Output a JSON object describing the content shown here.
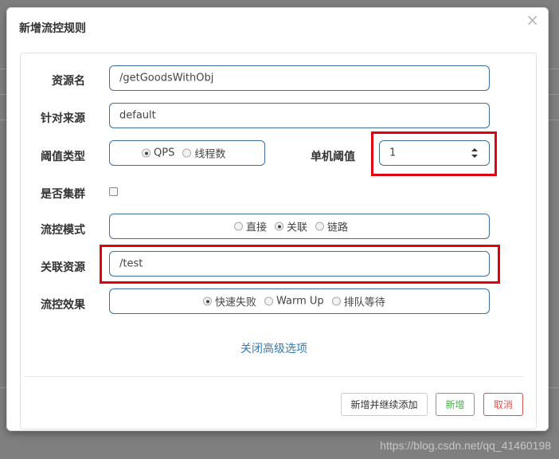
{
  "dialog": {
    "title": "新增流控规则",
    "close_glyph": "×"
  },
  "form": {
    "resource_name": {
      "label": "资源名",
      "value": "/getGoodsWithObj"
    },
    "limit_app": {
      "label": "针对来源",
      "value": "default"
    },
    "threshold_type": {
      "label": "阈值类型",
      "options": [
        "QPS",
        "线程数"
      ],
      "selected": "QPS"
    },
    "single_threshold": {
      "label": "单机阈值",
      "value": "1"
    },
    "cluster_mode": {
      "label": "是否集群",
      "checked": false
    },
    "strategy": {
      "label": "流控模式",
      "options": [
        "直接",
        "关联",
        "链路"
      ],
      "selected": "关联"
    },
    "ref_resource": {
      "label": "关联资源",
      "value": "/test"
    },
    "control_behavior": {
      "label": "流控效果",
      "options": [
        "快速失败",
        "Warm Up",
        "排队等待"
      ],
      "selected": "快速失败"
    },
    "advanced_toggle": "关闭高级选项"
  },
  "footer": {
    "add_and_continue": "新增并继续添加",
    "add": "新增",
    "cancel": "取消"
  },
  "watermark": "https://blog.csdn.net/qq_41460198",
  "colors": {
    "highlight_border": "#e3000f",
    "field_border": "#3f6e9c",
    "link": "#337ab7",
    "success": "#5cb85c",
    "danger": "#d9534f"
  },
  "icons": {
    "close": "close-icon",
    "spinner": "spinner-arrows-icon"
  }
}
